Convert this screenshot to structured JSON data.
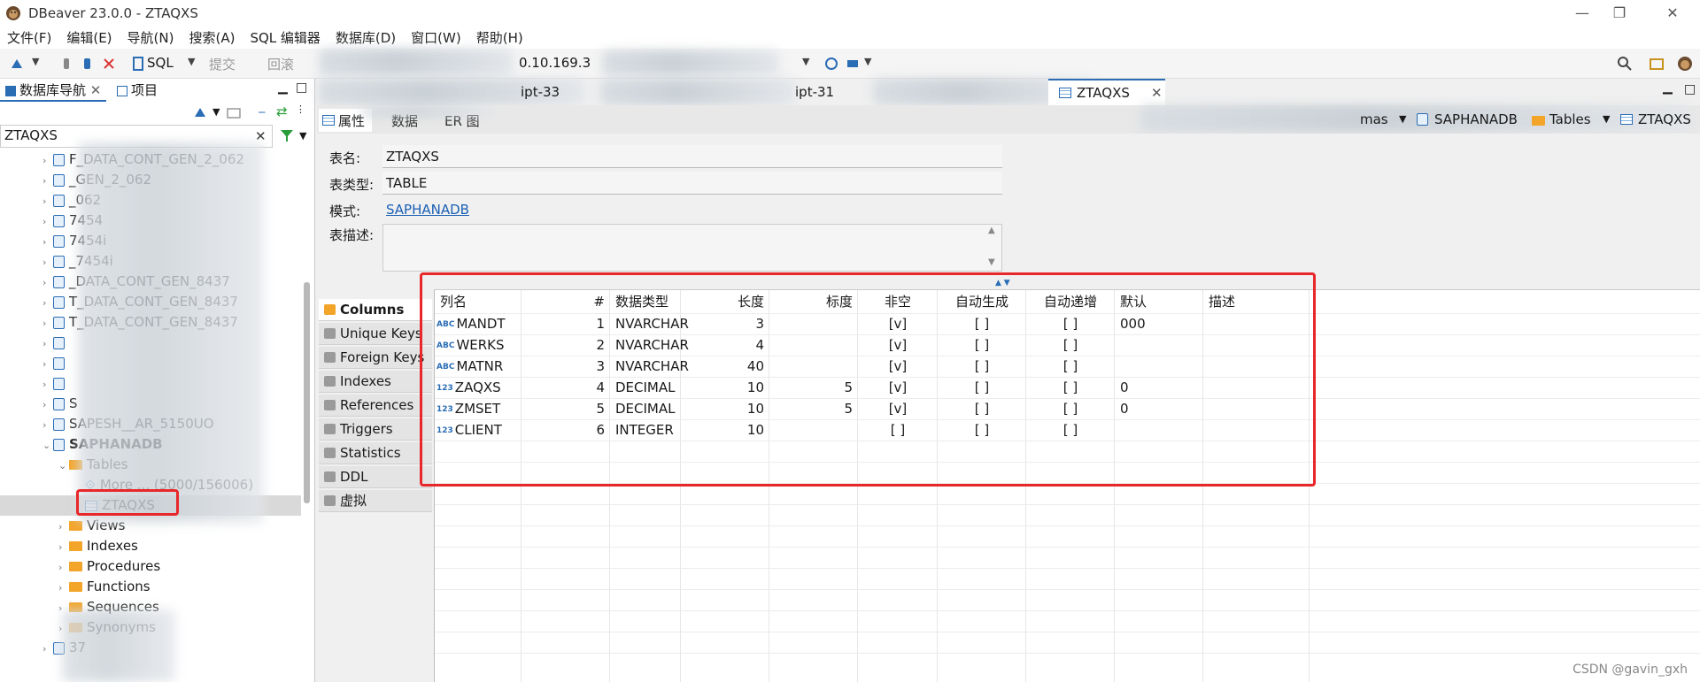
{
  "window": {
    "title": "DBeaver 23.0.0 - ZTAQXS",
    "controls": [
      "—",
      "❐",
      "✕"
    ]
  },
  "menu": [
    "文件(F)",
    "编辑(E)",
    "导航(N)",
    "搜索(A)",
    "SQL 编辑器",
    "数据库(D)",
    "窗口(W)",
    "帮助(H)"
  ],
  "toolbar": {
    "sql_label": "SQL",
    "commit_label": "提交",
    "rollback_label": "回滚",
    "host_partial": "0.10.169.3 "
  },
  "left_panel": {
    "tab_navigator": "数据库导航",
    "tab_projects": "项目",
    "filter_value": "ZTAQXS",
    "tree": [
      {
        "label": "F_DATA_CONT_GEN_2_062",
        "level": 1,
        "arrow": "›"
      },
      {
        "label": "_GEN_2_062",
        "level": 1,
        "arrow": "›"
      },
      {
        "label": "_062",
        "level": 1,
        "arrow": "›"
      },
      {
        "label": "7454",
        "level": 1,
        "arrow": "›"
      },
      {
        "label": "7454i",
        "level": 1,
        "arrow": "›"
      },
      {
        "label": "_7454i",
        "level": 1,
        "arrow": "›"
      },
      {
        "label": "_DATA_CONT_GEN_8437",
        "level": 1,
        "arrow": "›"
      },
      {
        "label": "T_DATA_CONT_GEN_8437",
        "level": 1,
        "arrow": "›"
      },
      {
        "label": "T_DATA_CONT_GEN_8437",
        "level": 1,
        "arrow": "›"
      },
      {
        "label": "",
        "level": 1,
        "arrow": "›"
      },
      {
        "label": "",
        "level": 1,
        "arrow": "›"
      },
      {
        "label": "",
        "level": 1,
        "arrow": "›"
      },
      {
        "label": "S",
        "level": 1,
        "arrow": "›"
      },
      {
        "label": "SAPESH__AR_5150UO",
        "level": 1,
        "arrow": "›"
      },
      {
        "label": "SAPHANADB",
        "level": 1,
        "arrow": "⌄",
        "bold": true
      },
      {
        "label": "Tables",
        "level": 2,
        "arrow": "⌄",
        "icon": "folder-table"
      },
      {
        "label": "More ... (5000/156006)",
        "level": 3,
        "arrow": "",
        "icon": "more"
      },
      {
        "label": "ZTAQXS",
        "level": 3,
        "arrow": "",
        "icon": "table",
        "selected": true
      },
      {
        "label": "Views",
        "level": 2,
        "arrow": "›",
        "icon": "folder"
      },
      {
        "label": "Indexes",
        "level": 2,
        "arrow": "›",
        "icon": "folder"
      },
      {
        "label": "Procedures",
        "level": 2,
        "arrow": "›",
        "icon": "folder"
      },
      {
        "label": "Functions",
        "level": 2,
        "arrow": "›",
        "icon": "folder"
      },
      {
        "label": "Sequences",
        "level": 2,
        "arrow": "›",
        "icon": "folder"
      },
      {
        "label": "Synonyms",
        "level": 2,
        "arrow": "›",
        "icon": "folder"
      },
      {
        "label": "37",
        "level": 1,
        "arrow": "›"
      }
    ]
  },
  "editor": {
    "tabs": [
      "ipt-33",
      "ipt-31",
      "ZTAQXS"
    ],
    "active_tab": "ZTAQXS",
    "subtabs": [
      "属性",
      "数据",
      "ER 图"
    ],
    "breadcrumb": [
      "mas",
      "SAPHANADB",
      "Tables",
      "ZTAQXS"
    ]
  },
  "properties": {
    "name_label": "表名:",
    "name_value": "ZTAQXS",
    "type_label": "表类型:",
    "type_value": "TABLE",
    "schema_label": "模式:",
    "schema_value": "SAPHANADB",
    "desc_label": "表描述:",
    "desc_value": ""
  },
  "side_tabs": [
    "Columns",
    "Unique Keys",
    "Foreign Keys",
    "Indexes",
    "References",
    "Triggers",
    "Statistics",
    "DDL",
    "虚拟"
  ],
  "columns_table": {
    "headers": [
      "列名",
      "#",
      "数据类型",
      "长度",
      "标度",
      "非空",
      "自动生成",
      "自动递增",
      "默认",
      "描述"
    ],
    "rows": [
      {
        "type_icon": "ABC",
        "name": "MANDT",
        "num": "1",
        "dtype": "NVARCHAR",
        "length": "3",
        "scale": "",
        "notnull": "[v]",
        "autogen": "[ ]",
        "autoinc": "[ ]",
        "default": "000",
        "desc": ""
      },
      {
        "type_icon": "ABC",
        "name": "WERKS",
        "num": "2",
        "dtype": "NVARCHAR",
        "length": "4",
        "scale": "",
        "notnull": "[v]",
        "autogen": "[ ]",
        "autoinc": "[ ]",
        "default": "",
        "desc": ""
      },
      {
        "type_icon": "ABC",
        "name": "MATNR",
        "num": "3",
        "dtype": "NVARCHAR",
        "length": "40",
        "scale": "",
        "notnull": "[v]",
        "autogen": "[ ]",
        "autoinc": "[ ]",
        "default": "",
        "desc": ""
      },
      {
        "type_icon": "123",
        "name": "ZAQXS",
        "num": "4",
        "dtype": "DECIMAL",
        "length": "10",
        "scale": "5",
        "notnull": "[v]",
        "autogen": "[ ]",
        "autoinc": "[ ]",
        "default": "0",
        "desc": ""
      },
      {
        "type_icon": "123",
        "name": "ZMSET",
        "num": "5",
        "dtype": "DECIMAL",
        "length": "10",
        "scale": "5",
        "notnull": "[v]",
        "autogen": "[ ]",
        "autoinc": "[ ]",
        "default": "0",
        "desc": ""
      },
      {
        "type_icon": "123",
        "name": "CLIENT",
        "num": "6",
        "dtype": "INTEGER",
        "length": "10",
        "scale": "",
        "notnull": "[ ]",
        "autogen": "[ ]",
        "autoinc": "[ ]",
        "default": "",
        "desc": ""
      }
    ]
  },
  "watermark": "CSDN @gavin_gxh",
  "colors": {
    "highlight": "#e8272a",
    "link": "#1a5fb4",
    "accent": "#2a6db5"
  }
}
